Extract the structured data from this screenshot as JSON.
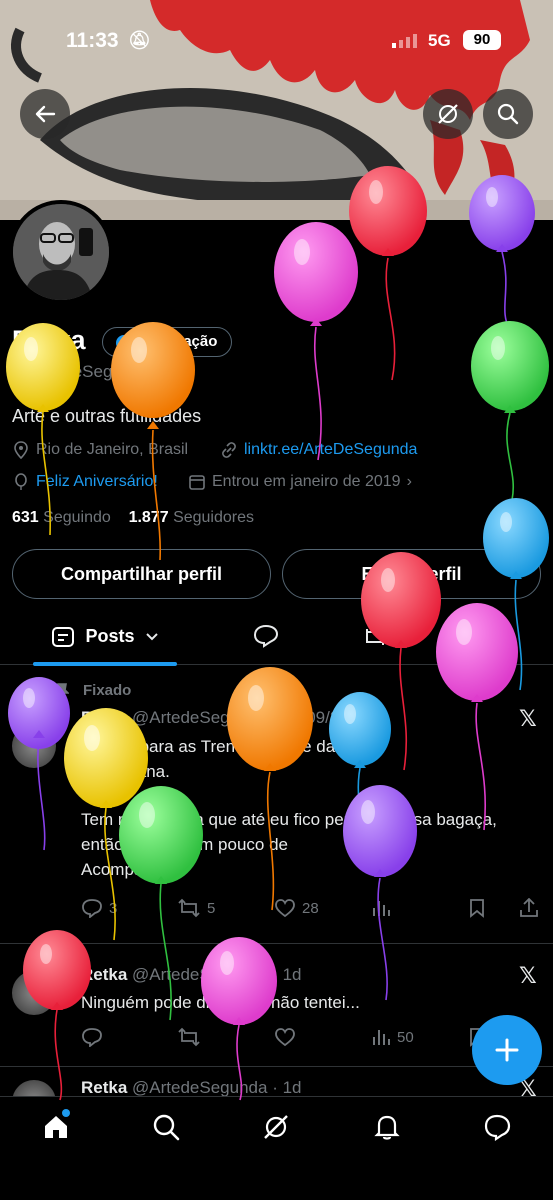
{
  "status_bar": {
    "time": "11:33",
    "network": "5G",
    "battery": "90"
  },
  "profile": {
    "name": "Retka",
    "verify_label": "verificação",
    "handle": "@ArteDeSegunda",
    "bio": "Arte e outras futilidades",
    "location": "Rio de Janeiro, Brasil",
    "link": "linktr.ee/ArteDeSegunda",
    "birthday": "Feliz Aniversário!",
    "joined": "Entrou em janeiro de 2019",
    "following_count": "631",
    "following_label": "Seguindo",
    "followers_count": "1.877",
    "followers_label": "Seguidores"
  },
  "buttons": {
    "share": "Compartilhar perfil",
    "edit": "Editar perfil"
  },
  "tabs": {
    "posts": "Posts"
  },
  "posts": [
    {
      "pinned_label": "Fixado",
      "author": "Retka",
      "handle": "@ArtedeSegunda",
      "date": "24/09/2020",
      "line1": "Thread para as Trends de Arte daqui",
      "line2": "na semana.",
      "line3": "Tem muita coisa que até eu fico perdido nessa bagaça,",
      "line4": "então vou pôr um pouco de",
      "line5": "Acompanhe!",
      "replies": "3",
      "reposts": "5",
      "likes": "28"
    },
    {
      "author": "Retka",
      "handle": "@ArtedeSegunda",
      "date": "1d",
      "text": "Ninguém pode dizer que não tentei...",
      "views": "50"
    },
    {
      "author": "Retka",
      "handle": "@ArtedeSegunda",
      "date": "1d"
    }
  ],
  "colors": {
    "accent": "#1d9bf0",
    "background": "#000000",
    "muted": "#71767b"
  },
  "icons": [
    "back-arrow-icon",
    "grok-icon",
    "search-icon",
    "home-icon",
    "notifications-icon",
    "messages-icon",
    "compose-icon"
  ]
}
